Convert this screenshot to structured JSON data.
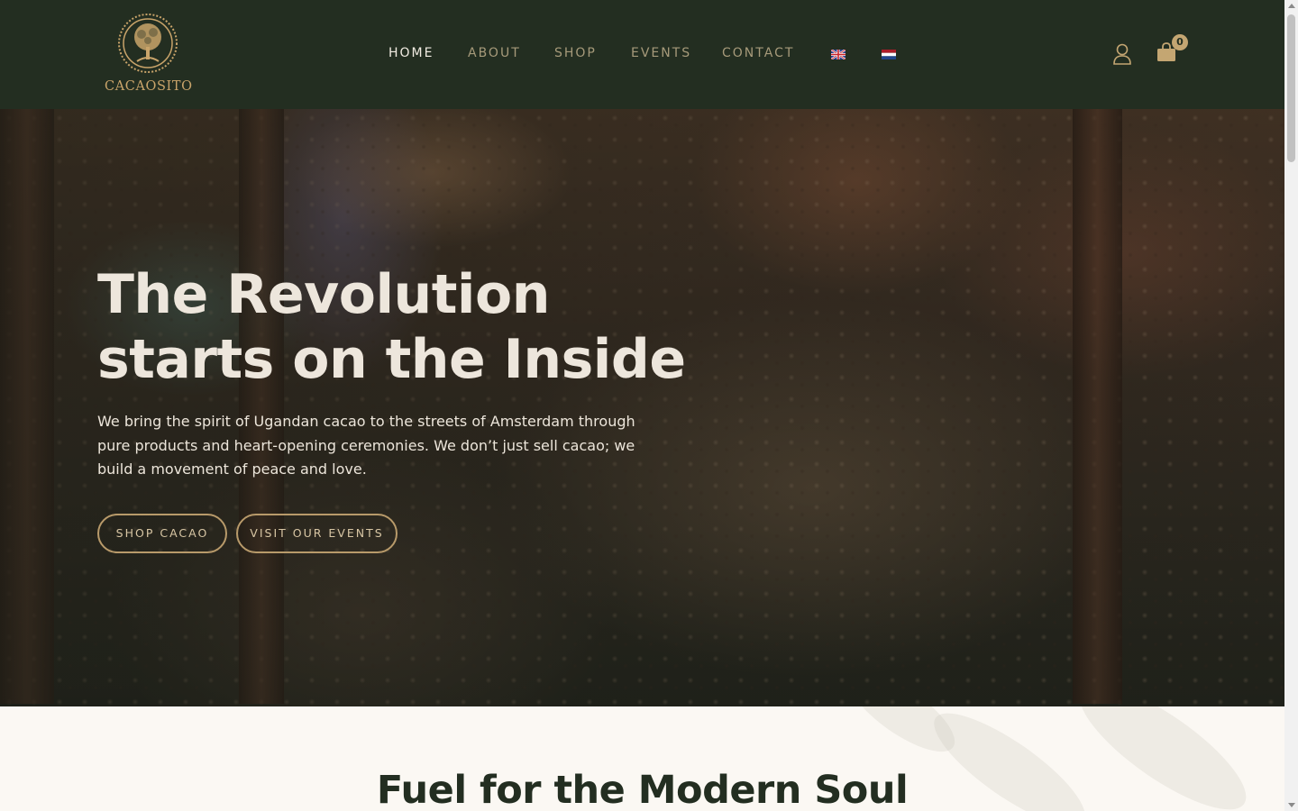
{
  "brand": {
    "name": "CACAOSITO",
    "logo_icon": "tree-of-life-icon",
    "accent": "#c9a46a"
  },
  "nav": {
    "items": [
      {
        "label": "HOME",
        "active": true
      },
      {
        "label": "ABOUT",
        "active": false
      },
      {
        "label": "SHOP",
        "active": false
      },
      {
        "label": "EVENTS",
        "active": false
      },
      {
        "label": "CONTACT",
        "active": false
      }
    ],
    "languages": [
      {
        "icon": "uk-flag-icon"
      },
      {
        "icon": "netherlands-flag-icon"
      }
    ]
  },
  "header_icons": {
    "account_icon": "user-icon",
    "cart_icon": "shopping-bag-icon",
    "cart_count": "0"
  },
  "hero": {
    "title_line1": "The Revolution",
    "title_line2": "starts on the Inside",
    "text": "We bring the spirit of Ugandan cacao to the streets of Amsterdam through pure products and heart-opening ceremonies. We don’t just sell cacao; we build a movement of peace and love.",
    "buttons": {
      "shop": "SHOP CACAO",
      "events": "VISIT OUR EVENTS"
    }
  },
  "section": {
    "title": "Fuel for the Modern Soul"
  },
  "colors": {
    "header_bg": "#232e21",
    "page_bg": "#fbf8f3",
    "button_border": "#b89a6a",
    "nav_inactive": "#a69a7a",
    "nav_active": "#f1ece2"
  }
}
